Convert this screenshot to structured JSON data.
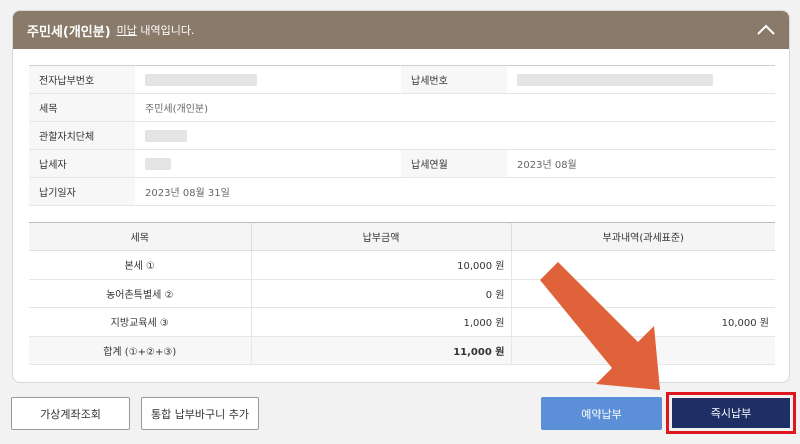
{
  "header": {
    "title": "주민세(개인분)",
    "status_word": "미납",
    "status_suffix": " 내역입니다."
  },
  "info": {
    "e_payment_no_label": "전자납부번호",
    "tax_no_label": "납세번호",
    "tax_item_label": "세목",
    "tax_item_value": "주민세(개인분)",
    "local_gov_label": "관할자치단체",
    "taxpayer_label": "납세자",
    "tax_month_label": "납세연월",
    "tax_month_value": "2023년 08월",
    "due_date_label": "납기일자",
    "due_date_value": "2023년 08월 31일"
  },
  "tax_table": {
    "headers": [
      "세목",
      "납부금액",
      "부과내역(과세표준)"
    ],
    "rows": [
      {
        "name": "본세 ①",
        "amount": "10,000 원",
        "base": ""
      },
      {
        "name": "농어촌특별세 ②",
        "amount": "0 원",
        "base": ""
      },
      {
        "name": "지방교육세 ③",
        "amount": "1,000 원",
        "base": "10,000 원"
      },
      {
        "name": "합계 (①+②+③)",
        "amount": "11,000 원",
        "base": ""
      }
    ]
  },
  "buttons": {
    "virtual_account": "가상계좌조회",
    "add_cart": "통합 납부바구니 추가",
    "reserve_pay": "예약납부",
    "pay_now": "즉시납부"
  },
  "colors": {
    "header_bg": "#8a7a6a",
    "reserve_btn": "#5b8fd8",
    "pay_btn": "#1e2f66",
    "highlight": "#e0161e",
    "arrow": "#e0623a"
  }
}
